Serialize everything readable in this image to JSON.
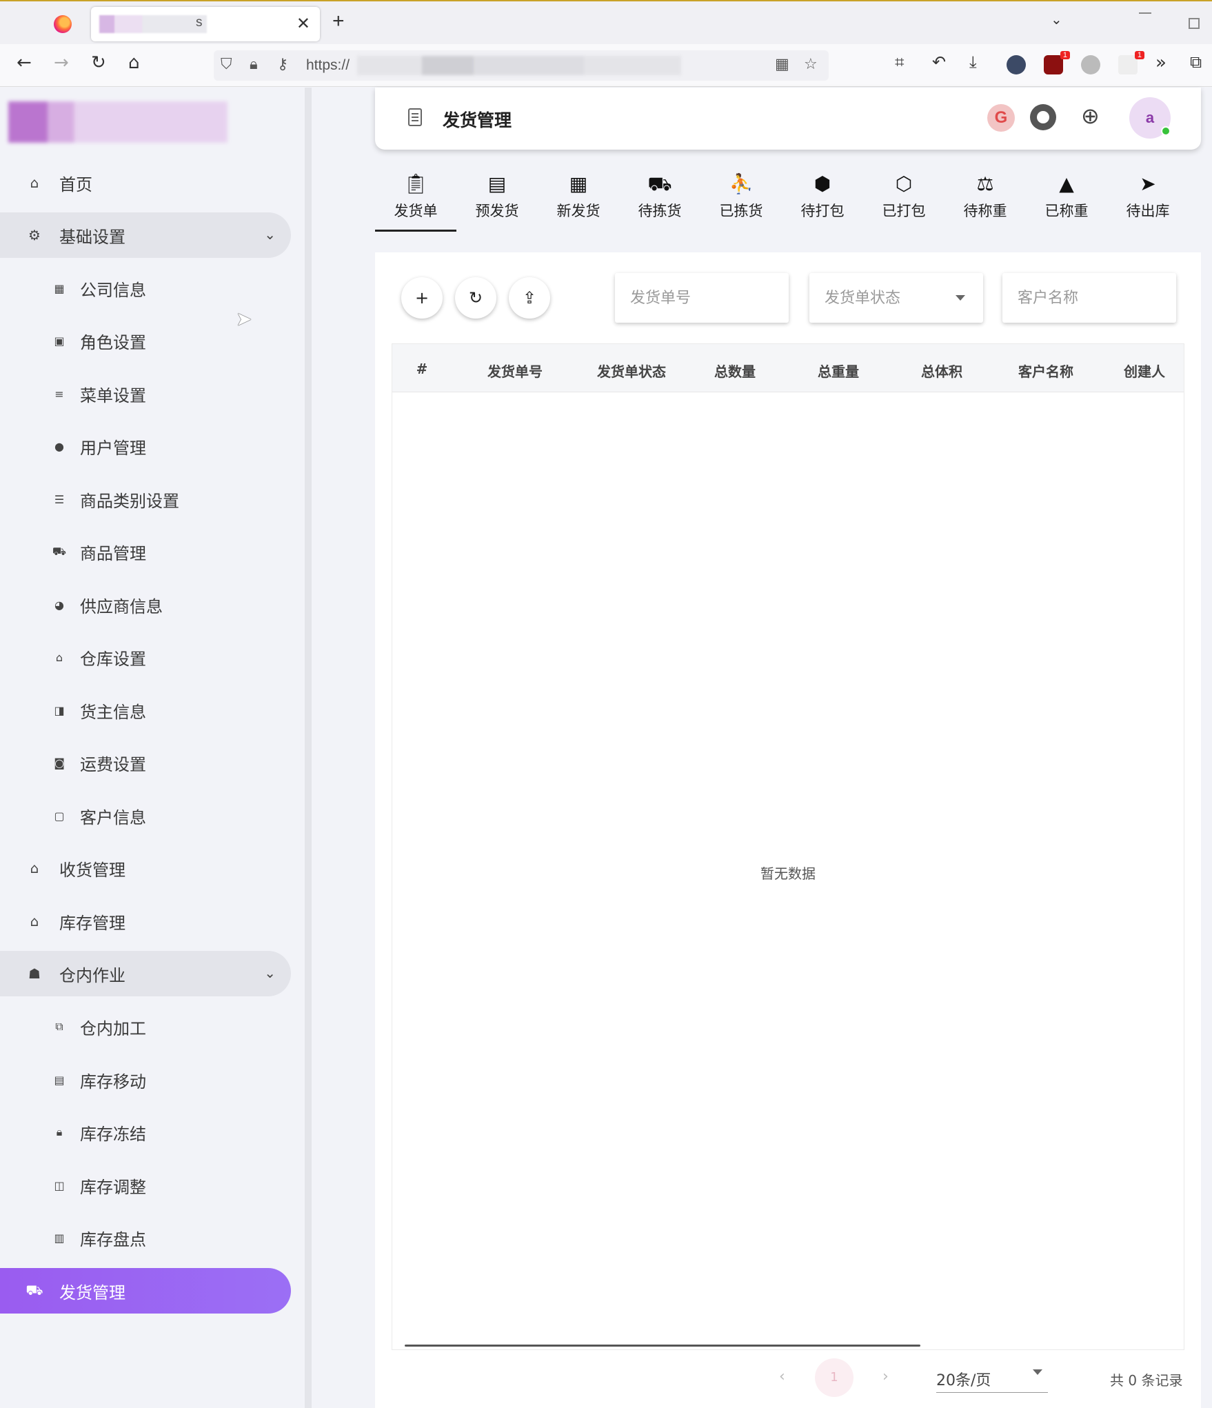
{
  "browser": {
    "url_prefix": "https://",
    "tab_title_suffix": "s"
  },
  "sidebar": {
    "items": [
      {
        "label": "首页",
        "icon": "home-icon",
        "level": "top"
      },
      {
        "label": "基础设置",
        "icon": "gear-icon",
        "level": "top",
        "expanded": true
      },
      {
        "label": "公司信息",
        "icon": "building-icon",
        "level": "sub"
      },
      {
        "label": "角色设置",
        "icon": "badge-icon",
        "level": "sub"
      },
      {
        "label": "菜单设置",
        "icon": "menu-icon",
        "level": "sub"
      },
      {
        "label": "用户管理",
        "icon": "person-icon",
        "level": "sub"
      },
      {
        "label": "商品类别设置",
        "icon": "list-icon",
        "level": "sub"
      },
      {
        "label": "商品管理",
        "icon": "cart-icon",
        "level": "sub"
      },
      {
        "label": "供应商信息",
        "icon": "supplier-icon",
        "level": "sub"
      },
      {
        "label": "仓库设置",
        "icon": "warehouse-icon",
        "level": "sub"
      },
      {
        "label": "货主信息",
        "icon": "owner-icon",
        "level": "sub"
      },
      {
        "label": "运费设置",
        "icon": "money-icon",
        "level": "sub"
      },
      {
        "label": "客户信息",
        "icon": "contact-icon",
        "level": "sub"
      },
      {
        "label": "收货管理",
        "icon": "receiving-icon",
        "level": "top"
      },
      {
        "label": "库存管理",
        "icon": "inventory-icon",
        "level": "top"
      },
      {
        "label": "仓内作业",
        "icon": "worker-icon",
        "level": "top",
        "expanded": true
      },
      {
        "label": "仓内加工",
        "icon": "process-icon",
        "level": "sub"
      },
      {
        "label": "库存移动",
        "icon": "move-icon",
        "level": "sub"
      },
      {
        "label": "库存冻结",
        "icon": "lock-icon",
        "level": "sub"
      },
      {
        "label": "库存调整",
        "icon": "adjust-icon",
        "level": "sub"
      },
      {
        "label": "库存盘点",
        "icon": "count-icon",
        "level": "sub"
      },
      {
        "label": "发货管理",
        "icon": "shipping-icon",
        "level": "top",
        "active": true
      }
    ]
  },
  "header": {
    "title": "发货管理",
    "g_badge": "G",
    "avatar_letter": "a"
  },
  "tabs": [
    {
      "label": "发货单",
      "icon": "clipboard-icon",
      "active": true
    },
    {
      "label": "预发货",
      "icon": "list-box-icon"
    },
    {
      "label": "新发货",
      "icon": "list-box-filled-icon"
    },
    {
      "label": "待拣货",
      "icon": "dolly-icon"
    },
    {
      "label": "已拣货",
      "icon": "person-dolly-icon"
    },
    {
      "label": "待打包",
      "icon": "package-icon"
    },
    {
      "label": "已打包",
      "icon": "package-outline-icon"
    },
    {
      "label": "待称重",
      "icon": "scale-icon"
    },
    {
      "label": "已称重",
      "icon": "weight-icon"
    },
    {
      "label": "待出库",
      "icon": "send-icon"
    }
  ],
  "filters": {
    "dispatch_no_placeholder": "发货单号",
    "status_placeholder": "发货单状态",
    "customer_placeholder": "客户名称"
  },
  "table": {
    "columns": [
      "#",
      "发货单号",
      "发货单状态",
      "总数量",
      "总重量",
      "总体积",
      "客户名称",
      "创建人"
    ],
    "rows": [],
    "empty_text": "暂无数据"
  },
  "pagination": {
    "current_page": "1",
    "page_size": "20条/页",
    "total_text": "共 0 条记录"
  },
  "colors": {
    "active_menu": "#9b5cf0",
    "background": "#f2f3f8"
  }
}
